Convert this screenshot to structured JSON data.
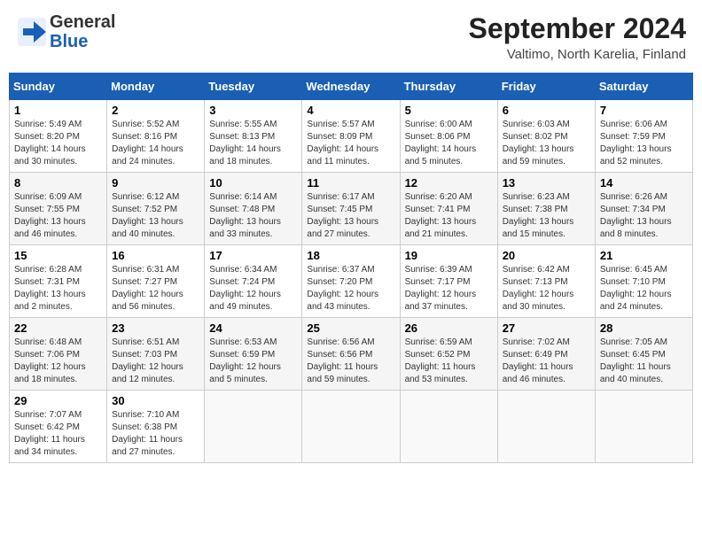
{
  "header": {
    "logo_line1": "General",
    "logo_line2": "Blue",
    "title": "September 2024",
    "subtitle": "Valtimo, North Karelia, Finland"
  },
  "calendar": {
    "days_of_week": [
      "Sunday",
      "Monday",
      "Tuesday",
      "Wednesday",
      "Thursday",
      "Friday",
      "Saturday"
    ],
    "weeks": [
      [
        {
          "day": "1",
          "info": "Sunrise: 5:49 AM\nSunset: 8:20 PM\nDaylight: 14 hours\nand 30 minutes."
        },
        {
          "day": "2",
          "info": "Sunrise: 5:52 AM\nSunset: 8:16 PM\nDaylight: 14 hours\nand 24 minutes."
        },
        {
          "day": "3",
          "info": "Sunrise: 5:55 AM\nSunset: 8:13 PM\nDaylight: 14 hours\nand 18 minutes."
        },
        {
          "day": "4",
          "info": "Sunrise: 5:57 AM\nSunset: 8:09 PM\nDaylight: 14 hours\nand 11 minutes."
        },
        {
          "day": "5",
          "info": "Sunrise: 6:00 AM\nSunset: 8:06 PM\nDaylight: 14 hours\nand 5 minutes."
        },
        {
          "day": "6",
          "info": "Sunrise: 6:03 AM\nSunset: 8:02 PM\nDaylight: 13 hours\nand 59 minutes."
        },
        {
          "day": "7",
          "info": "Sunrise: 6:06 AM\nSunset: 7:59 PM\nDaylight: 13 hours\nand 52 minutes."
        }
      ],
      [
        {
          "day": "8",
          "info": "Sunrise: 6:09 AM\nSunset: 7:55 PM\nDaylight: 13 hours\nand 46 minutes."
        },
        {
          "day": "9",
          "info": "Sunrise: 6:12 AM\nSunset: 7:52 PM\nDaylight: 13 hours\nand 40 minutes."
        },
        {
          "day": "10",
          "info": "Sunrise: 6:14 AM\nSunset: 7:48 PM\nDaylight: 13 hours\nand 33 minutes."
        },
        {
          "day": "11",
          "info": "Sunrise: 6:17 AM\nSunset: 7:45 PM\nDaylight: 13 hours\nand 27 minutes."
        },
        {
          "day": "12",
          "info": "Sunrise: 6:20 AM\nSunset: 7:41 PM\nDaylight: 13 hours\nand 21 minutes."
        },
        {
          "day": "13",
          "info": "Sunrise: 6:23 AM\nSunset: 7:38 PM\nDaylight: 13 hours\nand 15 minutes."
        },
        {
          "day": "14",
          "info": "Sunrise: 6:26 AM\nSunset: 7:34 PM\nDaylight: 13 hours\nand 8 minutes."
        }
      ],
      [
        {
          "day": "15",
          "info": "Sunrise: 6:28 AM\nSunset: 7:31 PM\nDaylight: 13 hours\nand 2 minutes."
        },
        {
          "day": "16",
          "info": "Sunrise: 6:31 AM\nSunset: 7:27 PM\nDaylight: 12 hours\nand 56 minutes."
        },
        {
          "day": "17",
          "info": "Sunrise: 6:34 AM\nSunset: 7:24 PM\nDaylight: 12 hours\nand 49 minutes."
        },
        {
          "day": "18",
          "info": "Sunrise: 6:37 AM\nSunset: 7:20 PM\nDaylight: 12 hours\nand 43 minutes."
        },
        {
          "day": "19",
          "info": "Sunrise: 6:39 AM\nSunset: 7:17 PM\nDaylight: 12 hours\nand 37 minutes."
        },
        {
          "day": "20",
          "info": "Sunrise: 6:42 AM\nSunset: 7:13 PM\nDaylight: 12 hours\nand 30 minutes."
        },
        {
          "day": "21",
          "info": "Sunrise: 6:45 AM\nSunset: 7:10 PM\nDaylight: 12 hours\nand 24 minutes."
        }
      ],
      [
        {
          "day": "22",
          "info": "Sunrise: 6:48 AM\nSunset: 7:06 PM\nDaylight: 12 hours\nand 18 minutes."
        },
        {
          "day": "23",
          "info": "Sunrise: 6:51 AM\nSunset: 7:03 PM\nDaylight: 12 hours\nand 12 minutes."
        },
        {
          "day": "24",
          "info": "Sunrise: 6:53 AM\nSunset: 6:59 PM\nDaylight: 12 hours\nand 5 minutes."
        },
        {
          "day": "25",
          "info": "Sunrise: 6:56 AM\nSunset: 6:56 PM\nDaylight: 11 hours\nand 59 minutes."
        },
        {
          "day": "26",
          "info": "Sunrise: 6:59 AM\nSunset: 6:52 PM\nDaylight: 11 hours\nand 53 minutes."
        },
        {
          "day": "27",
          "info": "Sunrise: 7:02 AM\nSunset: 6:49 PM\nDaylight: 11 hours\nand 46 minutes."
        },
        {
          "day": "28",
          "info": "Sunrise: 7:05 AM\nSunset: 6:45 PM\nDaylight: 11 hours\nand 40 minutes."
        }
      ],
      [
        {
          "day": "29",
          "info": "Sunrise: 7:07 AM\nSunset: 6:42 PM\nDaylight: 11 hours\nand 34 minutes."
        },
        {
          "day": "30",
          "info": "Sunrise: 7:10 AM\nSunset: 6:38 PM\nDaylight: 11 hours\nand 27 minutes."
        },
        {
          "day": "",
          "info": ""
        },
        {
          "day": "",
          "info": ""
        },
        {
          "day": "",
          "info": ""
        },
        {
          "day": "",
          "info": ""
        },
        {
          "day": "",
          "info": ""
        }
      ]
    ]
  }
}
